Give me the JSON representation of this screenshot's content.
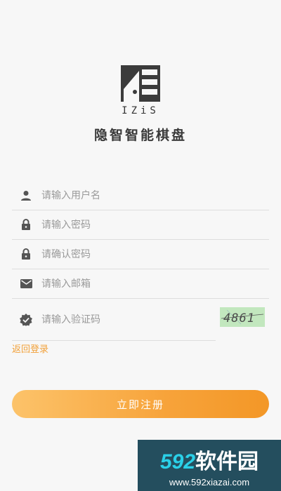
{
  "app": {
    "logo_text": "IZiS",
    "title": "隐智智能棋盘"
  },
  "form": {
    "username": {
      "placeholder": "请输入用户名",
      "value": "",
      "icon": "user-icon"
    },
    "password": {
      "placeholder": "请输入密码",
      "value": "",
      "icon": "lock-icon"
    },
    "confirm_password": {
      "placeholder": "请确认密码",
      "value": "",
      "icon": "lock-icon"
    },
    "email": {
      "placeholder": "请输入邮箱",
      "value": "",
      "icon": "mail-icon"
    },
    "captcha": {
      "placeholder": "请输入验证码",
      "value": "",
      "icon": "verified-badge-icon",
      "image_text": "4861"
    }
  },
  "links": {
    "back_to_login": "返回登录"
  },
  "buttons": {
    "register": "立即注册"
  },
  "watermark": {
    "brand_num": "592",
    "brand_cn": "软件园",
    "url": "www.592xiazai.com"
  },
  "colors": {
    "accent": "#f7a33a",
    "link": "#f2a13a",
    "background": "#f7f7f7",
    "icon": "#555555"
  }
}
